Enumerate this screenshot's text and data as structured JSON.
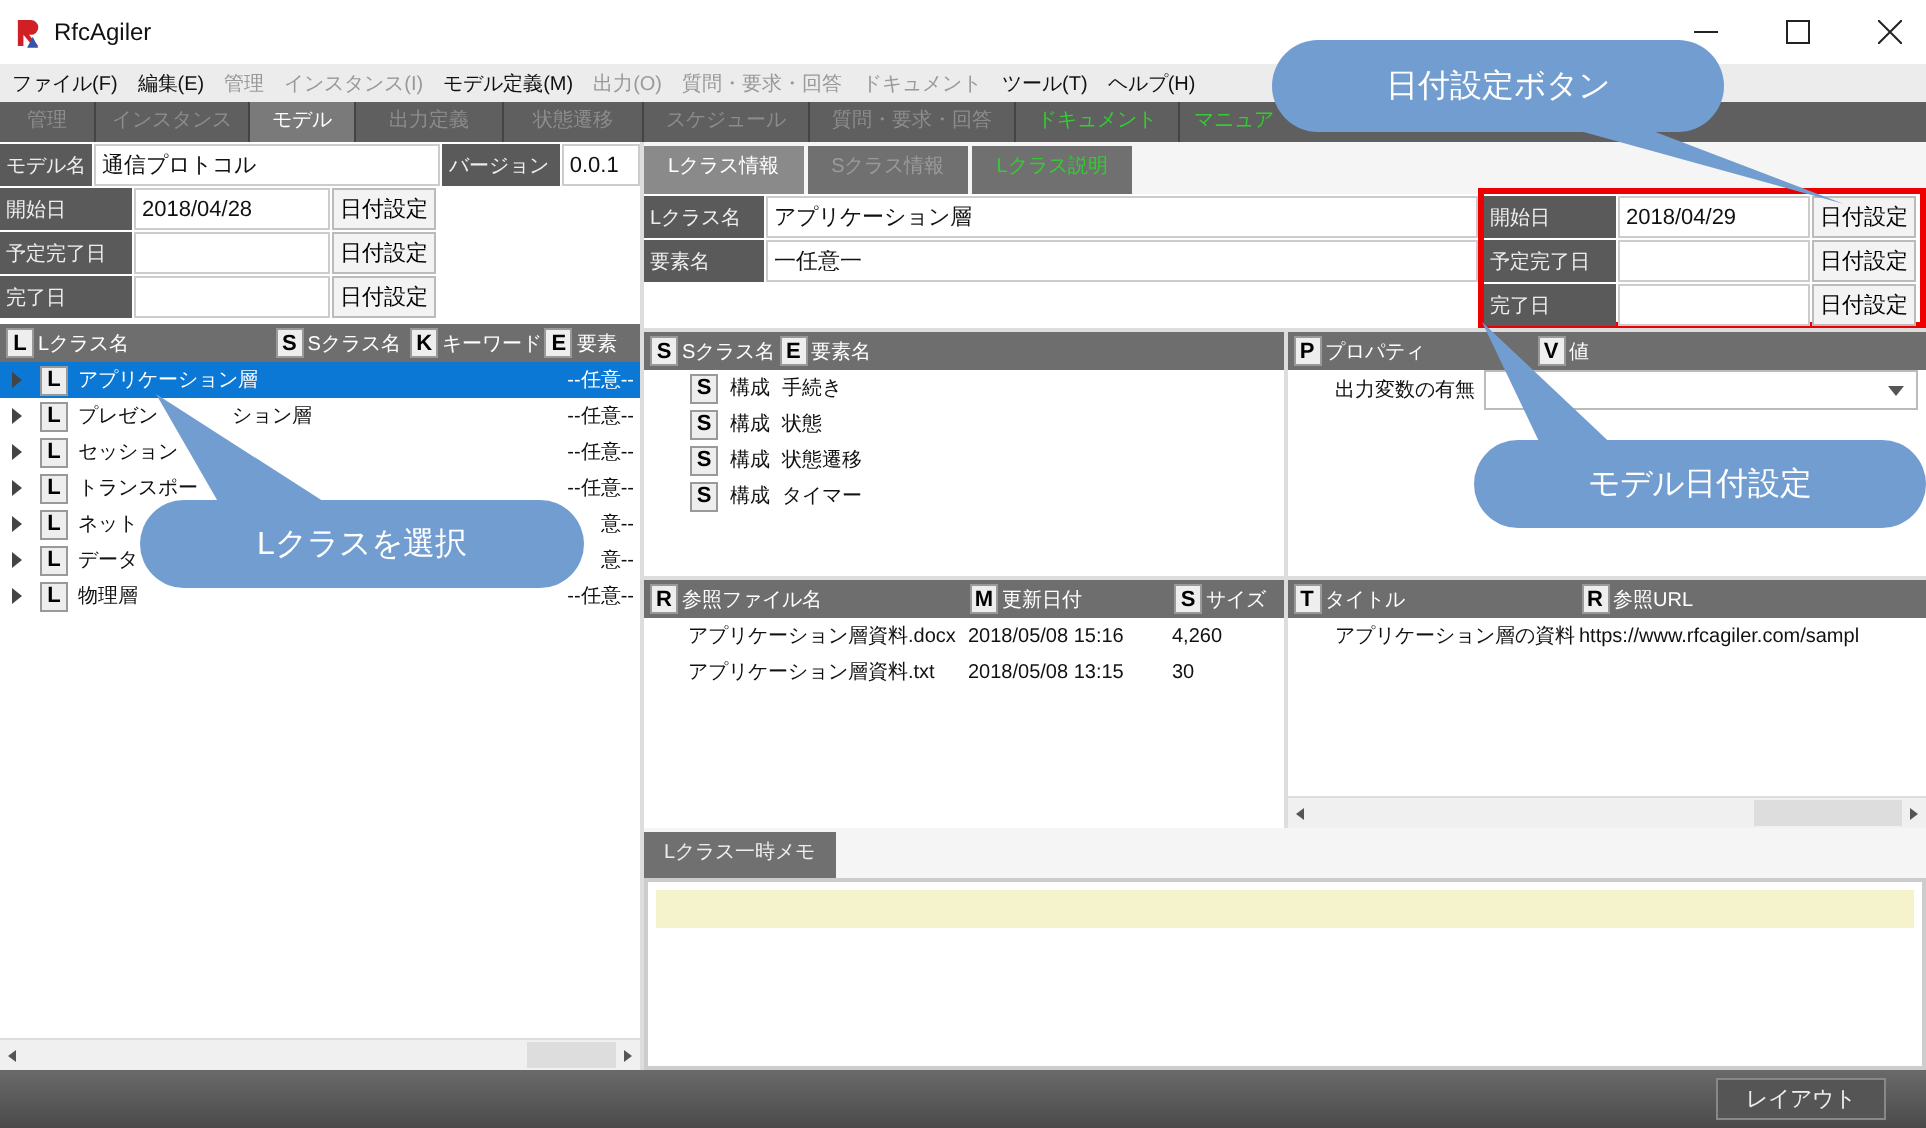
{
  "window": {
    "title": "RfcAgiler"
  },
  "menu": [
    {
      "label": "ファイル(F)",
      "disabled": false
    },
    {
      "label": "編集(E)",
      "disabled": false
    },
    {
      "label": "管理",
      "disabled": true
    },
    {
      "label": "インスタンス(I)",
      "disabled": true
    },
    {
      "label": "モデル定義(M)",
      "disabled": false
    },
    {
      "label": "出力(O)",
      "disabled": true
    },
    {
      "label": "質問・要求・回答",
      "disabled": true
    },
    {
      "label": "ドキュメント",
      "disabled": true
    },
    {
      "label": "ツール(T)",
      "disabled": false
    },
    {
      "label": "ヘルプ(H)",
      "disabled": false
    }
  ],
  "tabs": [
    {
      "label": "管理",
      "selected": false,
      "kind": "disabled"
    },
    {
      "label": "インスタンス",
      "selected": false,
      "kind": "disabled"
    },
    {
      "label": "モデル",
      "selected": true,
      "kind": "normal"
    },
    {
      "label": "出力定義",
      "selected": false,
      "kind": "disabled"
    },
    {
      "label": "状態遷移",
      "selected": false,
      "kind": "disabled"
    },
    {
      "label": "スケジュール",
      "selected": false,
      "kind": "disabled"
    },
    {
      "label": "質問・要求・回答",
      "selected": false,
      "kind": "disabled"
    },
    {
      "label": "ドキュメント",
      "selected": false,
      "kind": "link"
    },
    {
      "label": "マニュア",
      "selected": false,
      "kind": "link"
    }
  ],
  "model": {
    "name_label": "モデル名",
    "name": "通信プロトコル",
    "version_label": "バージョン",
    "version": "0.0.1"
  },
  "model_dates": [
    {
      "label": "開始日",
      "value": "2018/04/28",
      "button": "日付設定"
    },
    {
      "label": "予定完了日",
      "button": "日付設定"
    },
    {
      "label": "完了日",
      "button": "日付設定"
    }
  ],
  "tree": {
    "columns": [
      {
        "icon": "L",
        "label": "Lクラス名"
      },
      {
        "icon": "S",
        "label": "Sクラス名"
      },
      {
        "icon": "K",
        "label": "キーワード"
      },
      {
        "icon": "E",
        "label": "要素"
      }
    ],
    "rows": [
      {
        "icon": "L",
        "name": "アプリケーション層",
        "element": "--任意--",
        "selected": true
      },
      {
        "icon": "L",
        "name": "プレゼン",
        "name_after": "ション層",
        "element": "--任意--",
        "selected": false
      },
      {
        "icon": "L",
        "name": "セッション",
        "element": "--任意--",
        "selected": false
      },
      {
        "icon": "L",
        "name": "トランスポー",
        "element": "--任意--",
        "selected": false
      },
      {
        "icon": "L",
        "name": "ネット",
        "element": "意--",
        "selected": false
      },
      {
        "icon": "L",
        "name": "データ",
        "element": "意--",
        "selected": false
      },
      {
        "icon": "L",
        "name": "物理層",
        "element": "--任意--",
        "selected": false
      }
    ]
  },
  "detail_tabs": [
    {
      "label": "Lクラス情報",
      "selected": true,
      "kind": "normal"
    },
    {
      "label": "Sクラス情報",
      "selected": false,
      "kind": "disabled"
    },
    {
      "label": "Lクラス説明",
      "selected": false,
      "kind": "link"
    }
  ],
  "detail_fields": [
    {
      "label": "Lクラス名",
      "value": "アプリケーション層"
    },
    {
      "label": "要素名",
      "value": "一任意一"
    }
  ],
  "class_dates": [
    {
      "label": "開始日",
      "value": "2018/04/29",
      "button": "日付設定"
    },
    {
      "label": "予定完了日",
      "button": "日付設定"
    },
    {
      "label": "完了日",
      "button": "日付設定"
    }
  ],
  "sclass_list": {
    "columns": [
      {
        "icon": "S",
        "label": "Sクラス名"
      },
      {
        "icon": "E",
        "label": "要素名"
      }
    ],
    "rows": [
      {
        "icon": "S",
        "name": "構成",
        "element": "手続き"
      },
      {
        "icon": "S",
        "name": "構成",
        "element": "状態"
      },
      {
        "icon": "S",
        "name": "構成",
        "element": "状態遷移"
      },
      {
        "icon": "S",
        "name": "構成",
        "element": "タイマー"
      }
    ]
  },
  "properties": {
    "columns": [
      {
        "icon": "P",
        "label": "プロパティ"
      },
      {
        "icon": "V",
        "label": "値"
      }
    ],
    "rows": [
      {
        "name": "出力変数の有無"
      }
    ]
  },
  "ref_files": {
    "columns": [
      {
        "icon": "R",
        "label": "参照ファイル名"
      },
      {
        "icon": "M",
        "label": "更新日付"
      },
      {
        "icon": "S",
        "label": "サイズ"
      }
    ],
    "rows": [
      {
        "name": "アプリケーション層資料.docx",
        "date": "2018/05/08 15:16",
        "size": "4,260"
      },
      {
        "name": "アプリケーション層資料.txt",
        "date": "2018/05/08 13:15",
        "size": "30"
      }
    ]
  },
  "ref_urls": {
    "columns": [
      {
        "icon": "T",
        "label": "タイトル"
      },
      {
        "icon": "R",
        "label": "参照URL"
      }
    ],
    "rows": [
      {
        "title": "アプリケーション層の資料",
        "url": "https://www.rfcagiler.com/sampl"
      }
    ]
  },
  "memo": {
    "tab": "Lクラス一時メモ"
  },
  "status_bar": {
    "button": "レイアウト"
  },
  "callouts": [
    {
      "text": "日付設定ボタン"
    },
    {
      "text": "モデル日付設定"
    },
    {
      "text": "Lクラスを選択"
    }
  ]
}
